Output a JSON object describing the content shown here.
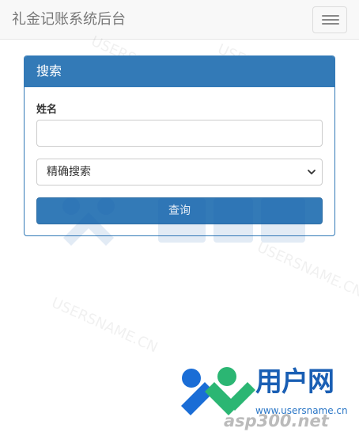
{
  "navbar": {
    "brand": "礼金记账系统后台",
    "toggle_label": "menu"
  },
  "panel": {
    "title": "搜索",
    "name_label": "姓名",
    "name_value": "",
    "name_placeholder": "",
    "search_mode": {
      "selected": "精确搜索"
    },
    "submit_label": "查询"
  },
  "watermark": {
    "text": "USERSNAME.CN",
    "logo_cn": "用户网",
    "logo_url": "www.usersname.cn",
    "logo_asp": "asp300.net"
  },
  "colors": {
    "primary": "#337ab7",
    "navbar_bg": "#f8f8f8",
    "brand_text": "#777777"
  },
  "icons": {
    "toggle": "hamburger-icon",
    "select": "chevron-down-icon"
  }
}
